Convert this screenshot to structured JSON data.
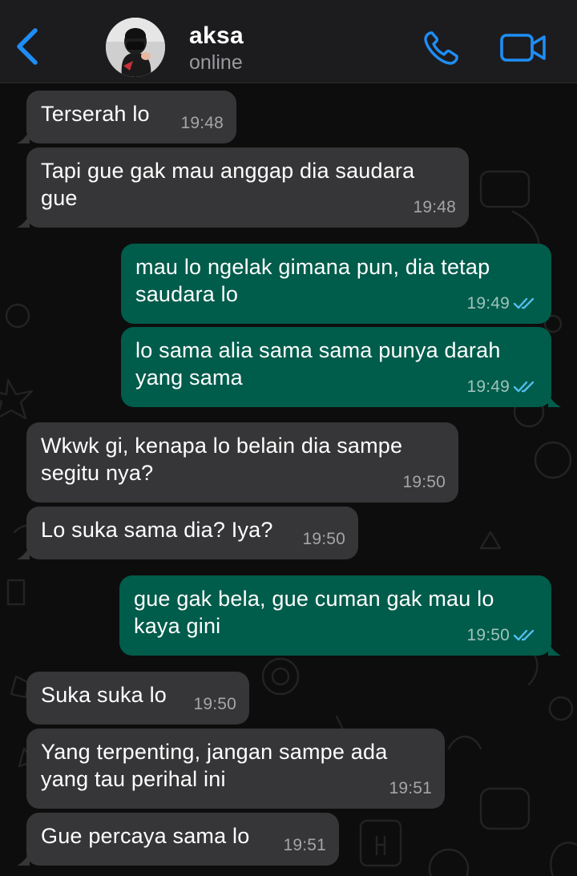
{
  "header": {
    "contact_name": "aksa",
    "status": "online"
  },
  "colors": {
    "header_bg": "#1c1c1e",
    "incoming_bubble": "#363638",
    "outgoing_bubble": "#005c4b",
    "accent": "#1e8ef5",
    "read_ticks": "#53bdeb"
  },
  "icons": {
    "back": "chevron-left-icon",
    "call": "phone-icon",
    "video": "video-camera-icon",
    "read": "double-check-icon"
  },
  "messages": [
    {
      "direction": "in",
      "text": "Terserah lo",
      "time": "19:48"
    },
    {
      "direction": "in",
      "text": "Tapi gue gak mau anggap dia saudara gue",
      "time": "19:48"
    },
    {
      "direction": "out",
      "text": "mau lo ngelak gimana pun, dia tetap saudara lo",
      "time": "19:49",
      "read": true
    },
    {
      "direction": "out",
      "text": "lo sama alia sama sama punya darah yang sama",
      "time": "19:49",
      "read": true
    },
    {
      "direction": "in",
      "text": "Wkwk gi, kenapa lo belain dia sampe segitu nya?",
      "time": "19:50"
    },
    {
      "direction": "in",
      "text": "Lo suka sama dia? Iya?",
      "time": "19:50"
    },
    {
      "direction": "out",
      "text": "gue gak bela, gue cuman gak mau lo kaya gini",
      "time": "19:50",
      "read": true
    },
    {
      "direction": "in",
      "text": "Suka suka lo",
      "time": "19:50"
    },
    {
      "direction": "in",
      "text": "Yang terpenting, jangan sampe ada yang tau perihal ini",
      "time": "19:51"
    },
    {
      "direction": "in",
      "text": "Gue percaya sama lo",
      "time": "19:51"
    }
  ]
}
